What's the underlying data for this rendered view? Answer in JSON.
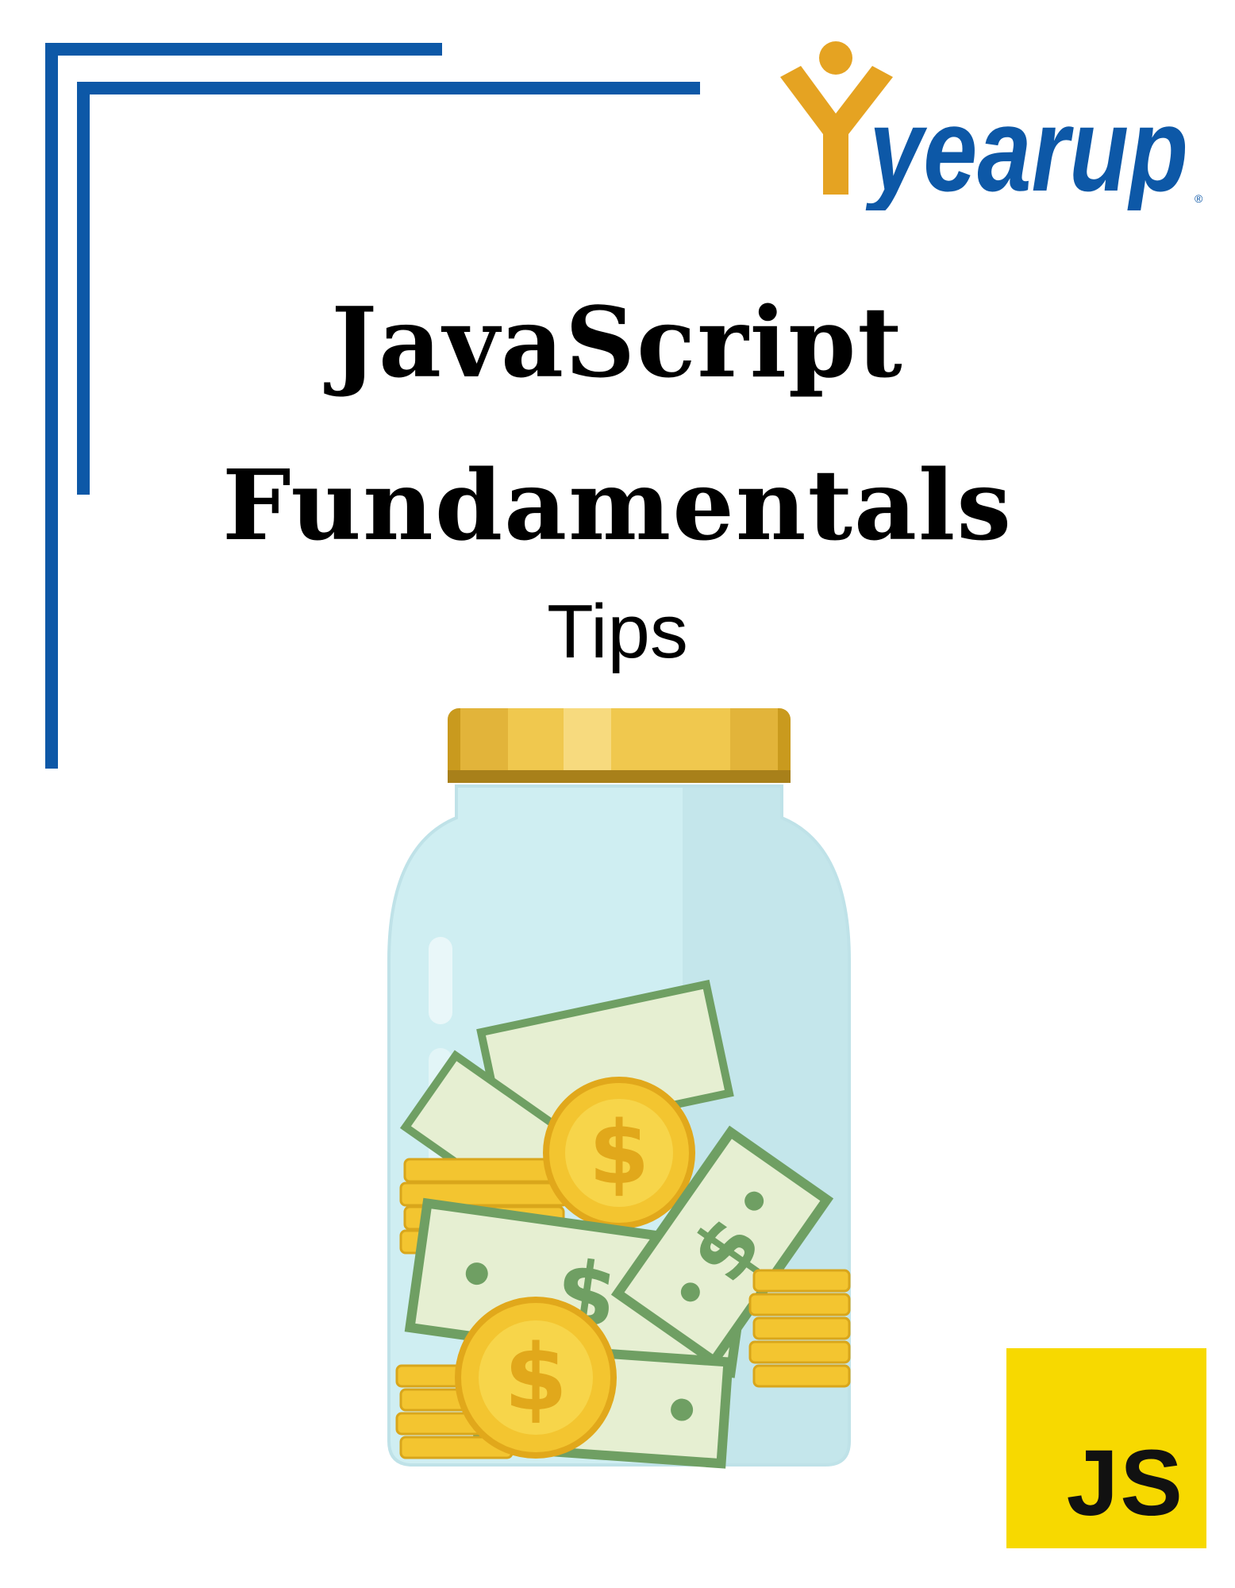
{
  "brand": {
    "name": "yearup",
    "registered_mark": "®",
    "primary_color": "#0d58a7",
    "accent_color": "#e5a322"
  },
  "title": {
    "line1": "JavaScript",
    "line2": "Fundamentals"
  },
  "subtitle": "Tips",
  "illustration": {
    "icon": "money-jar-icon"
  },
  "badge": {
    "text": "JS",
    "color": "#f7d900"
  }
}
